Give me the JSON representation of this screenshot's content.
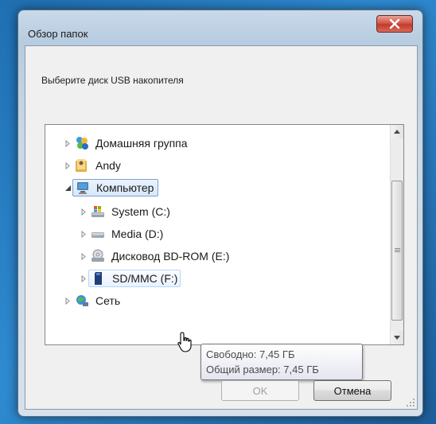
{
  "window": {
    "title": "Обзор папок",
    "prompt": "Выберите диск USB накопителя"
  },
  "tree": {
    "items": [
      {
        "label": "Домашняя группа",
        "icon": "homegroup-icon",
        "indent": 0,
        "expander": "collapsed"
      },
      {
        "label": "Andy",
        "icon": "user-folder-icon",
        "indent": 0,
        "expander": "collapsed"
      },
      {
        "label": "Компьютер",
        "icon": "computer-icon",
        "indent": 0,
        "expander": "expanded",
        "state": "selected"
      },
      {
        "label": "System (C:)",
        "icon": "system-drive-icon",
        "indent": 1,
        "expander": "collapsed"
      },
      {
        "label": "Media (D:)",
        "icon": "hard-drive-icon",
        "indent": 1,
        "expander": "collapsed"
      },
      {
        "label": "Дисковод BD-ROM (E:)",
        "icon": "optical-drive-icon",
        "indent": 1,
        "expander": "collapsed"
      },
      {
        "label": "SD/MMC (F:)",
        "icon": "sd-card-icon",
        "indent": 1,
        "expander": "collapsed",
        "state": "hover"
      },
      {
        "label": "Сеть",
        "icon": "network-icon",
        "indent": 0,
        "expander": "collapsed"
      }
    ]
  },
  "tooltip": {
    "line1": "Свободно: 7,45 ГБ",
    "line2": "Общий размер: 7,45 ГБ"
  },
  "buttons": {
    "ok": "OK",
    "cancel": "Отмена"
  },
  "colors": {
    "selection_border": "#7da2ce",
    "close_button": "#c23b2d"
  }
}
